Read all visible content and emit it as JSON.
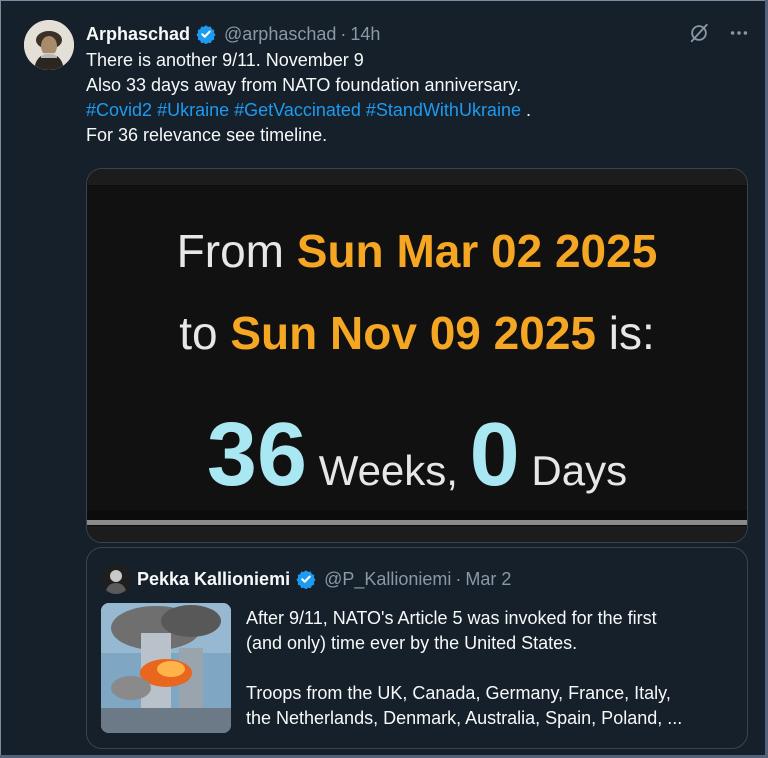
{
  "tweet": {
    "author_name": "Arphaschad",
    "handle": "@arphaschad",
    "separator": "·",
    "time": "14h",
    "lines": [
      "There is another 9/11. November 9",
      "Also 33 days away from NATO foundation anniversary."
    ],
    "hashtags": [
      "#Covid2",
      "#Ukraine",
      "#GetVaccinated",
      "#StandWithUkraine"
    ],
    "hashtag_tail": ".",
    "last_line": "For 36 relevance see timeline."
  },
  "media": {
    "from_label": "From",
    "from_date": "Sun Mar 02 2025",
    "to_label": "to",
    "to_date": "Sun Nov 09 2025",
    "is_label": "is:",
    "weeks_value": "36",
    "weeks_label": "Weeks,",
    "days_value": "0",
    "days_label": "Days"
  },
  "quote": {
    "author_name": "Pekka Kallioniemi",
    "handle": "@P_Kallioniemi",
    "separator": "·",
    "date": "Mar 2",
    "lines": [
      "After 9/11, NATO's Article 5 was invoked for the first",
      "(and only) time ever by the United States.",
      "",
      "Troops from the UK, Canada, Germany, France, Italy,",
      "the Netherlands, Denmark, Australia, Spain, Poland, ..."
    ]
  },
  "colors": {
    "background": "#15202b",
    "accent": "#1d9bf0",
    "orange": "#f5a623",
    "cyan": "#a9e8f2"
  },
  "icons": {
    "verified": "verified-badge-icon",
    "grok": "grok-icon",
    "more": "more-icon"
  }
}
